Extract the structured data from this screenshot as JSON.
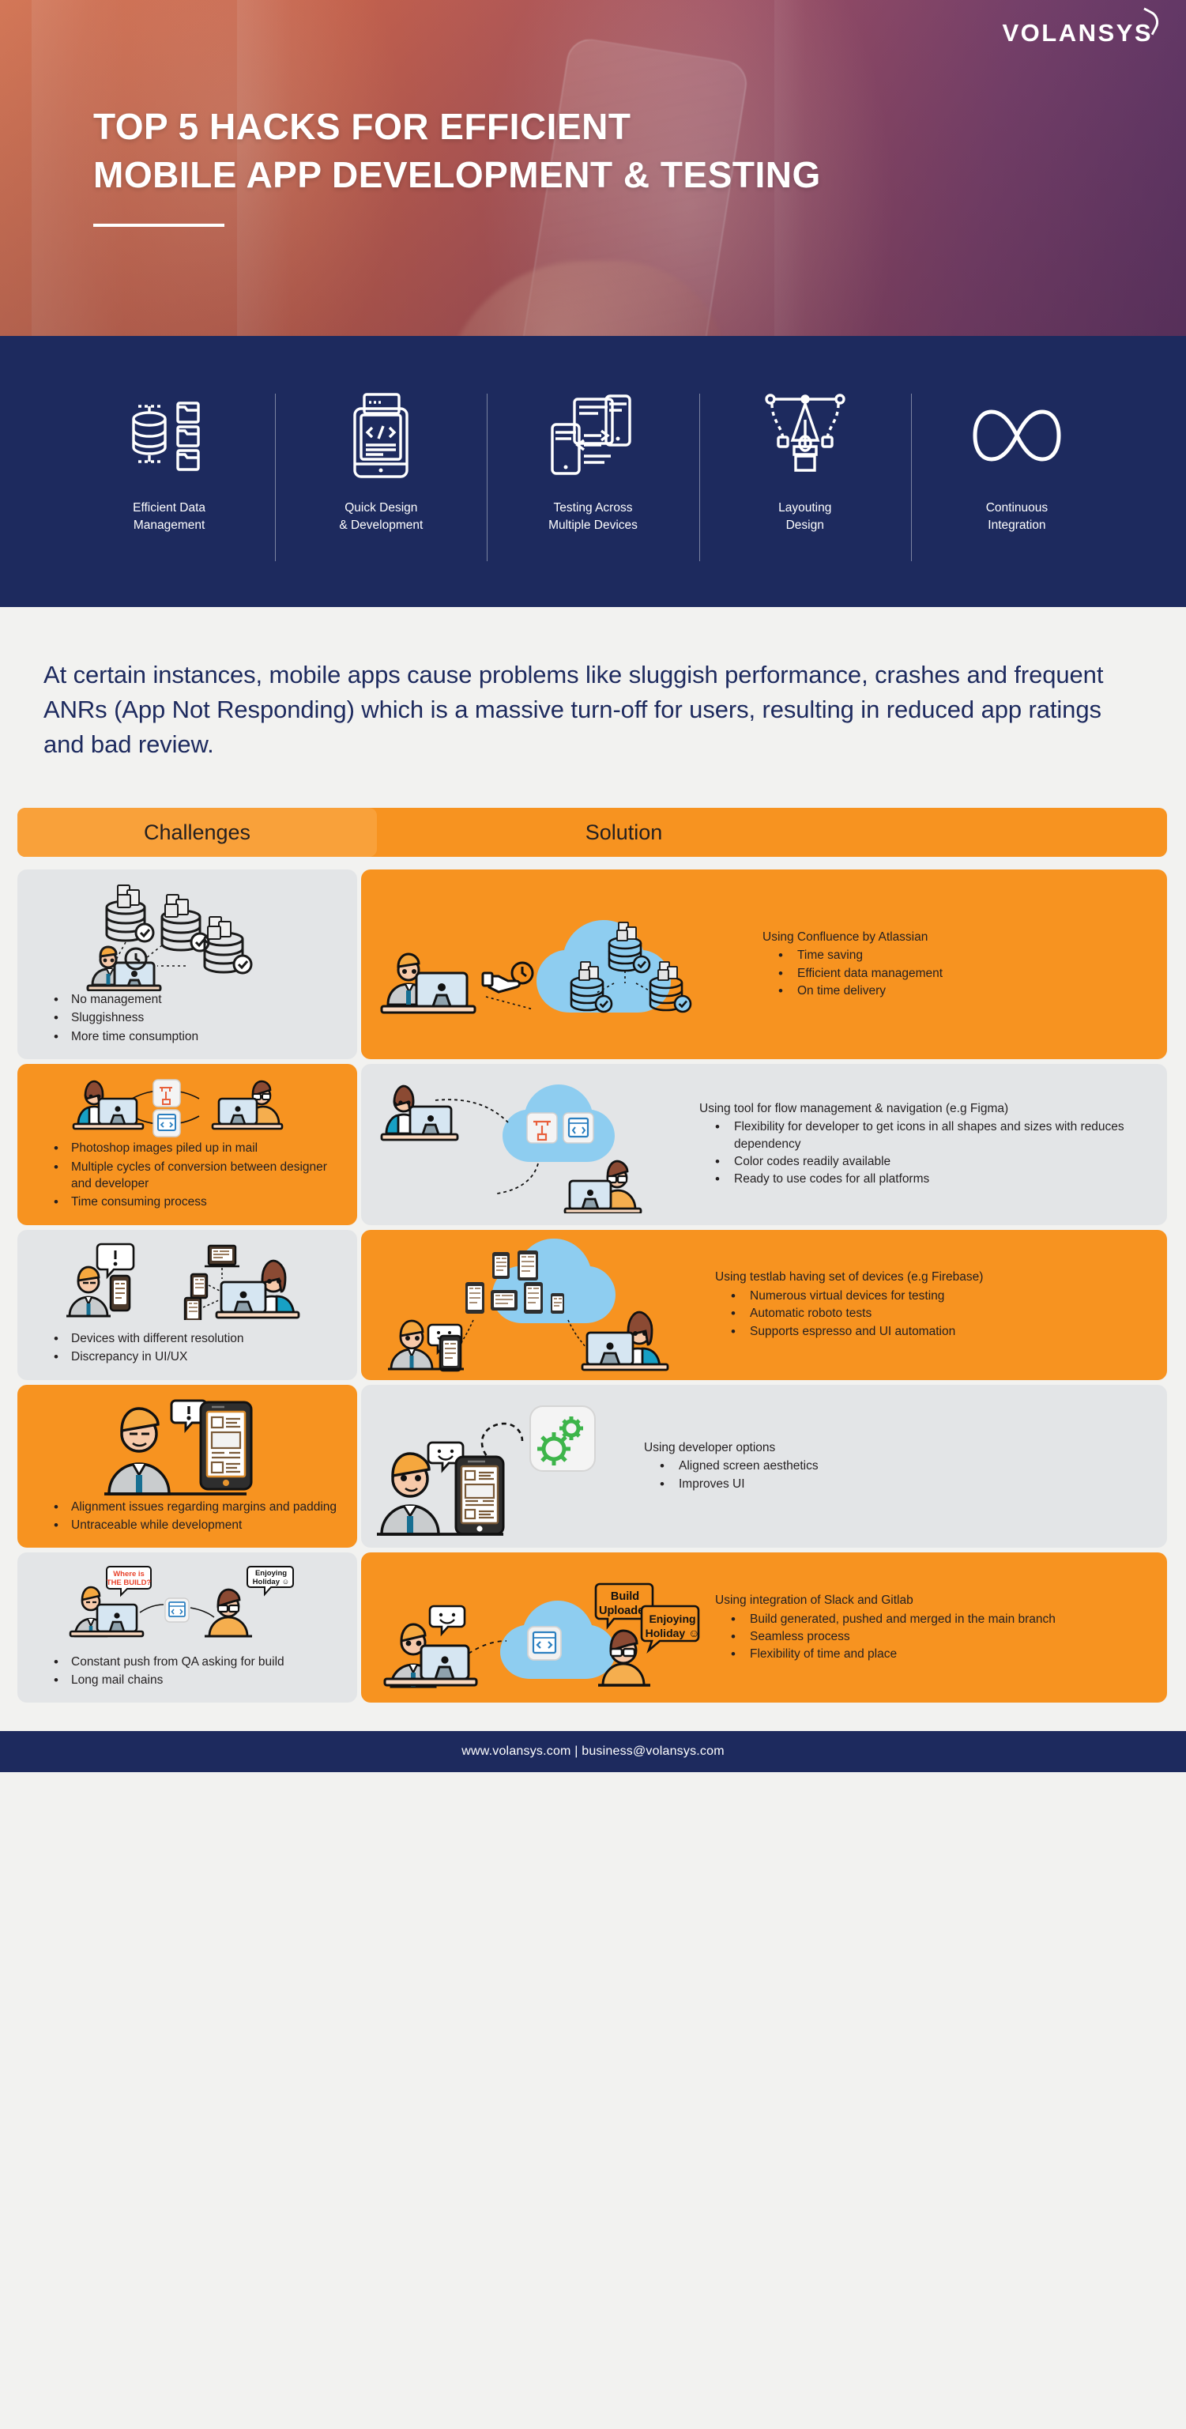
{
  "hero": {
    "logo": "VOLANSYS",
    "title_line1": "TOP 5 HACKS FOR EFFICIENT",
    "title_line2": "MOBILE APP DEVELOPMENT & TESTING"
  },
  "strip": {
    "items": [
      {
        "icon": "database-documents-icon",
        "label": "Efficient Data\nManagement"
      },
      {
        "icon": "mobile-code-icon",
        "label": "Quick Design\n& Development"
      },
      {
        "icon": "multi-device-sync-icon",
        "label": "Testing Across\nMultiple Devices"
      },
      {
        "icon": "pen-tool-icon",
        "label": "Layouting\nDesign"
      },
      {
        "icon": "infinity-icon",
        "label": "Continuous\nIntegration"
      }
    ]
  },
  "intro": {
    "paragraph": "At certain instances, mobile apps cause problems like sluggish performance, crashes and frequent ANRs (App Not Responding) which is a massive turn-off for users, resulting in reduced app ratings and bad review."
  },
  "headers": {
    "challenges": "Challenges",
    "solution": "Solution"
  },
  "rows": [
    {
      "challenge_bg": "grey",
      "solution_bg": "orange",
      "challenge_illustration": "person-at-desk-with-scattered-databases-illustration",
      "solution_illustration": "person-at-desk-with-cloud-databases-illustration",
      "challenges": [
        "No management",
        "Sluggishness",
        "More time consumption"
      ],
      "solution_lead": "Using Confluence by Atlassian",
      "solution_points": [
        "Time saving",
        "Efficient data management",
        "On time delivery"
      ]
    },
    {
      "challenge_bg": "orange",
      "solution_bg": "grey",
      "challenge_illustration": "designer-and-developer-exchanging-files-illustration",
      "solution_illustration": "designer-developer-cloud-tools-illustration",
      "challenges": [
        "Photoshop images piled up in mail",
        "Multiple cycles of conversion between designer and developer",
        "Time consuming process"
      ],
      "solution_lead": "Using tool for flow management & navigation (e.g Figma)",
      "solution_points": [
        "Flexibility for developer to get icons in all shapes and sizes with reduces dependency",
        "Color codes readily available",
        "Ready to use codes for all platforms"
      ]
    },
    {
      "challenge_bg": "grey",
      "solution_bg": "orange",
      "challenge_illustration": "frustrated-tester-with-multiple-devices-illustration",
      "solution_illustration": "device-testlab-cloud-illustration",
      "challenges": [
        "Devices with different resolution",
        "Discrepancy in UI/UX"
      ],
      "solution_lead": "Using testlab having set of devices (e.g Firebase)",
      "solution_points": [
        "Numerous virtual devices for testing",
        "Automatic roboto tests",
        "Supports espresso and UI automation"
      ]
    },
    {
      "challenge_bg": "orange",
      "solution_bg": "grey",
      "challenge_illustration": "person-with-misaligned-mobile-layout-illustration",
      "solution_illustration": "person-with-aligned-layout-and-gears-illustration",
      "challenges": [
        "Alignment issues regarding margins and padding",
        "Untraceable while development"
      ],
      "solution_lead": "Using developer options",
      "solution_points": [
        "Aligned screen aesthetics",
        "Improves UI"
      ]
    },
    {
      "challenge_bg": "grey",
      "solution_bg": "orange",
      "challenge_illustration": "qa-asking-for-build-illustration",
      "solution_illustration": "build-uploaded-to-cloud-illustration",
      "challenges": [
        "Constant push from QA asking for build",
        "Long mail chains"
      ],
      "solution_lead": "Using integration of Slack and Gitlab",
      "solution_points": [
        "Build generated, pushed and merged in the main branch",
        "Seamless process",
        "Flexibility of time and place"
      ],
      "callouts": {
        "challenge_bubble_1": "Where is\nTHE BUILD?",
        "challenge_bubble_2": "Enjoying\nHoliday ☺",
        "solution_bubble_1": "Build\nUploaded",
        "solution_bubble_2": "Enjoying\nHoliday ☺"
      }
    }
  ],
  "footer": {
    "text": "www.volansys.com | business@volansys.com"
  },
  "colors": {
    "navy": "#1d2a5e",
    "orange": "#f79320",
    "orange_light": "#f9a13a",
    "grey": "#e3e5e7",
    "cloud_blue": "#8ecdf0",
    "page_bg": "#f2f2f0"
  }
}
